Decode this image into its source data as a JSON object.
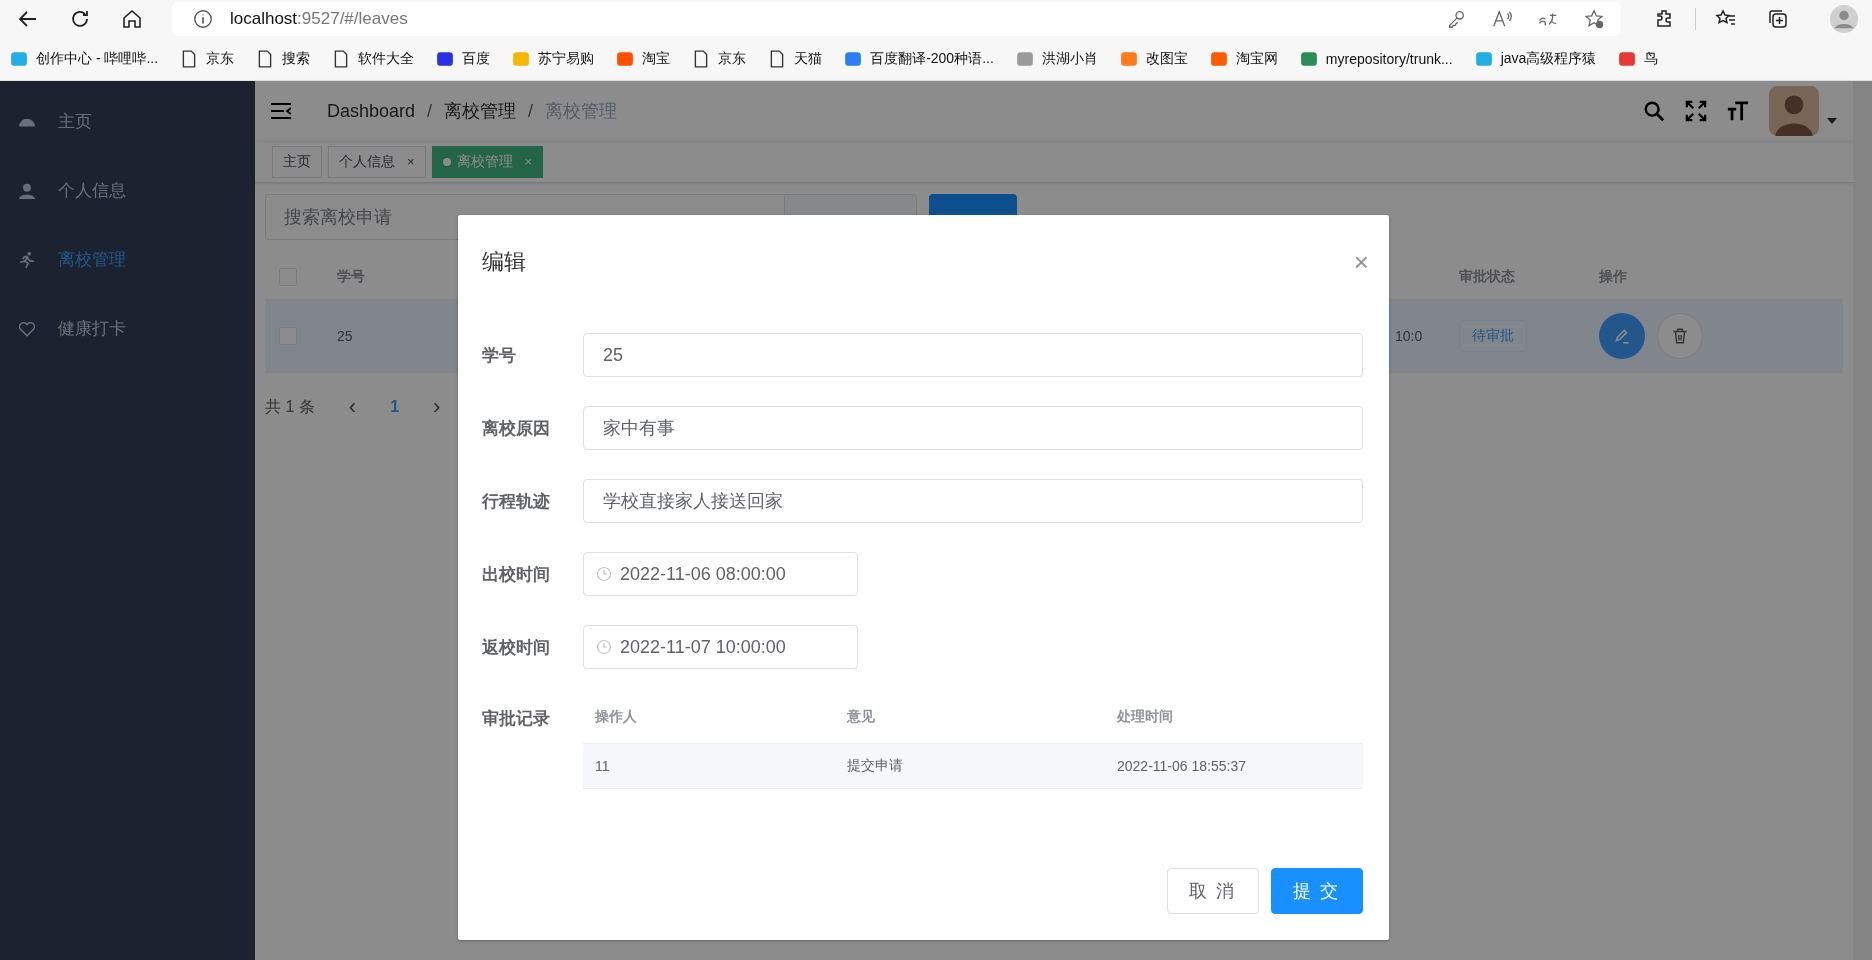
{
  "browser": {
    "url_host": "localhost",
    "url_path": ":9527/#/leaves",
    "bookmarks": [
      {
        "label": "创作中心 - 哔哩哔...",
        "kind": "favicon",
        "color": "#23ade5"
      },
      {
        "label": "京东",
        "kind": "page"
      },
      {
        "label": "搜索",
        "kind": "page"
      },
      {
        "label": "软件大全",
        "kind": "page"
      },
      {
        "label": "百度",
        "kind": "favicon",
        "color": "#2932e1"
      },
      {
        "label": "苏宁易购",
        "kind": "favicon",
        "color": "#f5b800"
      },
      {
        "label": "淘宝",
        "kind": "favicon",
        "color": "#ff5000"
      },
      {
        "label": "京东",
        "kind": "page"
      },
      {
        "label": "天猫",
        "kind": "page"
      },
      {
        "label": "百度翻译-200种语...",
        "kind": "favicon",
        "color": "#2f7df6"
      },
      {
        "label": "洪湖小肖",
        "kind": "favicon",
        "color": "#9a9a9a"
      },
      {
        "label": "改图宝",
        "kind": "favicon",
        "color": "#ff7a1a"
      },
      {
        "label": "淘宝网",
        "kind": "favicon",
        "color": "#ff5a00"
      },
      {
        "label": "myrepository/trunk...",
        "kind": "favicon",
        "color": "#2e8b57"
      },
      {
        "label": "java高级程序猿",
        "kind": "favicon",
        "color": "#23ade5"
      },
      {
        "label": "鸟",
        "kind": "favicon",
        "color": "#e53935"
      }
    ]
  },
  "sidebar": {
    "items": [
      {
        "label": "主页",
        "selected": false
      },
      {
        "label": "个人信息",
        "selected": false
      },
      {
        "label": "离校管理",
        "selected": true
      },
      {
        "label": "健康打卡",
        "selected": false
      }
    ]
  },
  "breadcrumb": {
    "separator": "/",
    "items": [
      "Dashboard",
      "离校管理",
      "离校管理"
    ]
  },
  "tags": [
    {
      "label": "主页",
      "selected": false
    },
    {
      "label": "个人信息",
      "selected": false,
      "close": "×"
    },
    {
      "label": "离校管理",
      "selected": true,
      "close": "×"
    }
  ],
  "search": {
    "placeholder": "搜索离校申请"
  },
  "table": {
    "select_all": {
      "checked": false
    },
    "columns": [
      "学号",
      "",
      "审批状态",
      "操作"
    ],
    "rows": [
      {
        "checked": false,
        "student_id": "25",
        "time": "10:0",
        "status": "待审批",
        "highlighted": true
      }
    ]
  },
  "pagination": {
    "total": "共 1 条",
    "prev": "‹",
    "page": "1",
    "next": "›"
  },
  "dialog": {
    "title": "编辑",
    "close": "×",
    "fields": [
      {
        "label": "学号",
        "value": "25",
        "kind": "text"
      },
      {
        "label": "离校原因",
        "value": "家中有事",
        "kind": "text"
      },
      {
        "label": "行程轨迹",
        "value": "学校直接家人接送回家",
        "kind": "text"
      },
      {
        "label": "出校时间",
        "value": "2022-11-06 08:00:00",
        "kind": "date"
      },
      {
        "label": "返校时间",
        "value": "2022-11-07 10:00:00",
        "kind": "date"
      }
    ],
    "records": {
      "label": "审批记录",
      "columns": [
        "操作人",
        "意见",
        "处理时间"
      ],
      "rows": [
        [
          "11",
          "提交申请",
          "2022-11-06 18:55:37"
        ]
      ]
    },
    "buttons": [
      {
        "label": "取 消",
        "kind": "default"
      },
      {
        "label": "提 交",
        "kind": "primary"
      }
    ]
  }
}
